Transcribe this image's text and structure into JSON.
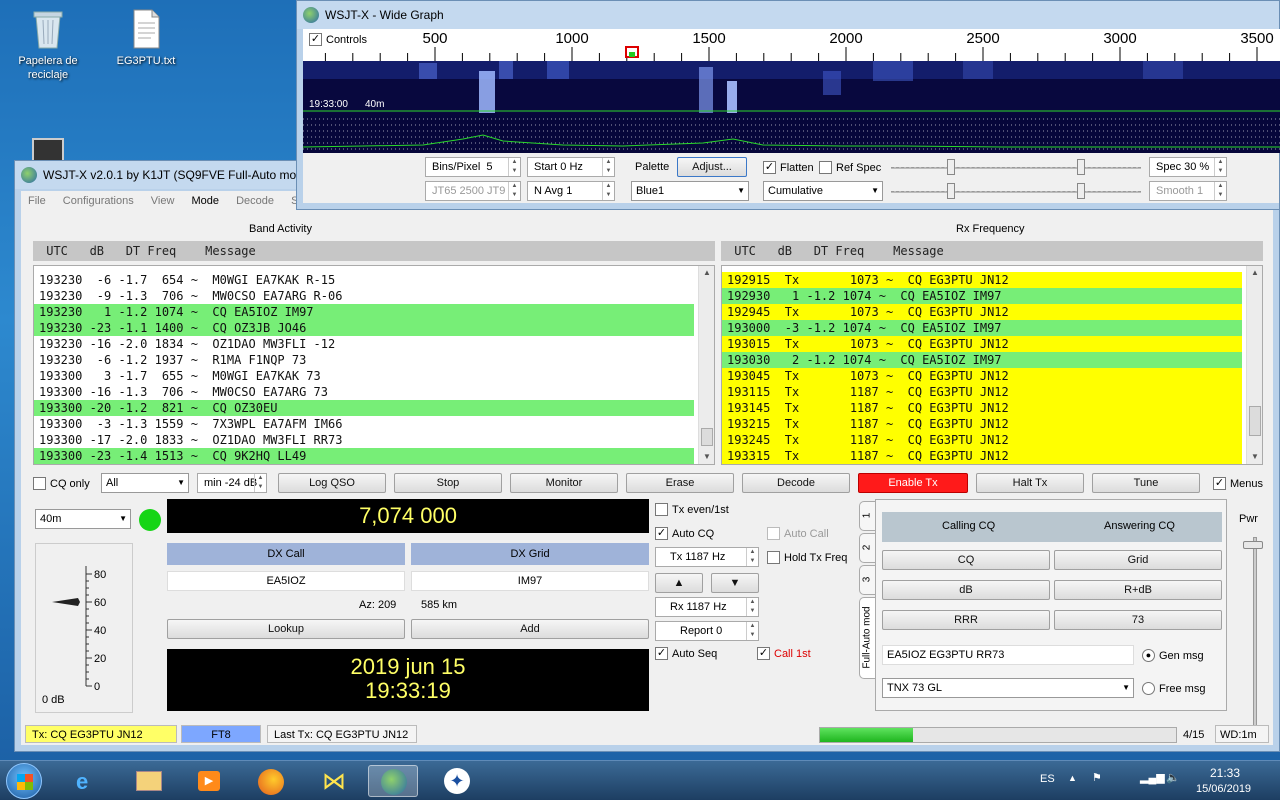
{
  "desktop": {
    "icons": [
      {
        "label": "Papelera de reciclaje"
      },
      {
        "label": "EG3PTU.txt"
      }
    ]
  },
  "wide_graph": {
    "title": "WSJT-X - Wide Graph",
    "controls_label": "Controls",
    "freq_ticks": [
      "500",
      "1000",
      "1500",
      "2000",
      "2500",
      "3000",
      "3500"
    ],
    "waterfall_time": "19:33:00",
    "waterfall_band": "40m",
    "bins_pixel_label": "Bins/Pixel",
    "bins_pixel_value": "5",
    "start_value": "Start 0 Hz",
    "mode_hint": "JT65  2500  JT9",
    "navg_value": "N Avg 1",
    "palette_label": "Palette",
    "adjust_label": "Adjust...",
    "palette_value": "Blue1",
    "flatten_label": "Flatten",
    "ref_spec_label": "Ref Spec",
    "spec_type_value": "Cumulative",
    "spec_value": "Spec 30 %",
    "smooth_value": "Smooth  1"
  },
  "main_window": {
    "title": "WSJT-X   v2.0.1   by K1JT (SQ9FVE Full-Auto mo",
    "menu": [
      "File",
      "Configurations",
      "View",
      "Mode",
      "Decode",
      "Sa"
    ],
    "band_activity": {
      "title": "Band Activity",
      "header": " UTC   dB   DT Freq    Message",
      "rows": [
        {
          "text": "193230  -6 -1.7  654 ~  M0WGI EA7KAK R-15",
          "hl": ""
        },
        {
          "text": "193230  -9 -1.3  706 ~  MW0CSO EA7ARG R-06",
          "hl": ""
        },
        {
          "text": "193230   1 -1.2 1074 ~  CQ EA5IOZ IM97",
          "hl": "green"
        },
        {
          "text": "193230 -23 -1.1 1400 ~  CQ OZ3JB JO46",
          "hl": "green"
        },
        {
          "text": "193230 -16 -2.0 1834 ~  OZ1DAO MW3FLI -12",
          "hl": ""
        },
        {
          "text": "193230  -6 -1.2 1937 ~  R1MA F1NQP 73",
          "hl": ""
        },
        {
          "text": "193300   3 -1.7  655 ~  M0WGI EA7KAK 73",
          "hl": ""
        },
        {
          "text": "193300 -16 -1.3  706 ~  MW0CSO EA7ARG 73",
          "hl": ""
        },
        {
          "text": "193300 -20 -1.2  821 ~  CQ OZ30EU",
          "hl": "green"
        },
        {
          "text": "193300  -3 -1.3 1559 ~  7X3WPL EA7AFM IM66",
          "hl": ""
        },
        {
          "text": "193300 -17 -2.0 1833 ~  OZ1DAO MW3FLI RR73",
          "hl": ""
        },
        {
          "text": "193300 -23 -1.4 1513 ~  CQ 9K2HQ LL49",
          "hl": "green"
        }
      ]
    },
    "rx_frequency": {
      "title": "Rx Frequency",
      "header": " UTC   dB   DT Freq    Message",
      "rows": [
        {
          "text": "192915  Tx       1073 ~  CQ EG3PTU JN12",
          "hl": "yellow"
        },
        {
          "text": "192930   1 -1.2 1074 ~  CQ EA5IOZ IM97",
          "hl": "green"
        },
        {
          "text": "192945  Tx       1073 ~  CQ EG3PTU JN12",
          "hl": "yellow"
        },
        {
          "text": "193000  -3 -1.2 1074 ~  CQ EA5IOZ IM97",
          "hl": "green"
        },
        {
          "text": "193015  Tx       1073 ~  CQ EG3PTU JN12",
          "hl": "yellow"
        },
        {
          "text": "193030   2 -1.2 1074 ~  CQ EA5IOZ IM97",
          "hl": "green"
        },
        {
          "text": "193045  Tx       1073 ~  CQ EG3PTU JN12",
          "hl": "yellow"
        },
        {
          "text": "193115  Tx       1187 ~  CQ EG3PTU JN12",
          "hl": "yellow"
        },
        {
          "text": "193145  Tx       1187 ~  CQ EG3PTU JN12",
          "hl": "yellow"
        },
        {
          "text": "193215  Tx       1187 ~  CQ EG3PTU JN12",
          "hl": "yellow"
        },
        {
          "text": "193245  Tx       1187 ~  CQ EG3PTU JN12",
          "hl": "yellow"
        },
        {
          "text": "193315  Tx       1187 ~  CQ EG3PTU JN12",
          "hl": "yellow"
        }
      ]
    },
    "controls": {
      "cq_only": "CQ only",
      "filter_value": "All",
      "min_db": "min -24 dB",
      "log_qso": "Log QSO",
      "stop": "Stop",
      "monitor": "Monitor",
      "erase": "Erase",
      "decode": "Decode",
      "enable_tx": "Enable Tx",
      "halt_tx": "Halt Tx",
      "tune": "Tune",
      "menus": "Menus"
    },
    "band_value": "40m",
    "frequency": "7,074 000",
    "dx_call_label": "DX Call",
    "dx_grid_label": "DX Grid",
    "dx_call_value": "EA5IOZ",
    "dx_grid_value": "IM97",
    "azimuth": "Az: 209",
    "distance": "585 km",
    "lookup": "Lookup",
    "add": "Add",
    "date": "2019 jun 15",
    "time": "19:33:19",
    "meter": {
      "ticks": [
        "80",
        "60",
        "40",
        "20",
        "0"
      ],
      "value_label": "0 dB",
      "level_db": 60
    },
    "tx_panel": {
      "tx_even": "Tx even/1st",
      "auto_cq": "Auto CQ",
      "auto_call": "Auto Call",
      "tx_freq": "Tx  1187 Hz",
      "hold_tx_freq": "Hold Tx Freq",
      "up_arrow": "▲",
      "down_arrow": "▼",
      "rx_freq": "Rx  1187 Hz",
      "report": "Report 0",
      "auto_seq": "Auto Seq",
      "call_1st": "Call 1st"
    },
    "tabs": [
      "1",
      "2",
      "3",
      "Full-Auto mod"
    ],
    "calling_cq": "Calling CQ",
    "answering_cq": "Answering CQ",
    "msg_buttons": [
      [
        "CQ",
        "Grid"
      ],
      [
        "dB",
        "R+dB"
      ],
      [
        "RRR",
        "73"
      ]
    ],
    "gen_msg_value": "EA5IOZ EG3PTU RR73",
    "gen_msg_label": "Gen msg",
    "free_msg_value": "TNX 73 GL",
    "free_msg_label": "Free msg",
    "pwr_label": "Pwr",
    "status": {
      "tx": "Tx: CQ EG3PTU JN12",
      "mode": "FT8",
      "last_tx": "Last Tx: CQ EG3PTU JN12",
      "progress_pct": 26,
      "period": "4/15",
      "wd": "WD:1m"
    }
  },
  "taskbar": {
    "lang": "ES",
    "time": "21:33",
    "date": "15/06/2019"
  },
  "colors": {
    "green_row": "#77ee77",
    "yellow_row": "#ffff00",
    "enable_tx": "#ff1a1a",
    "freq_text": "#ffff66"
  }
}
